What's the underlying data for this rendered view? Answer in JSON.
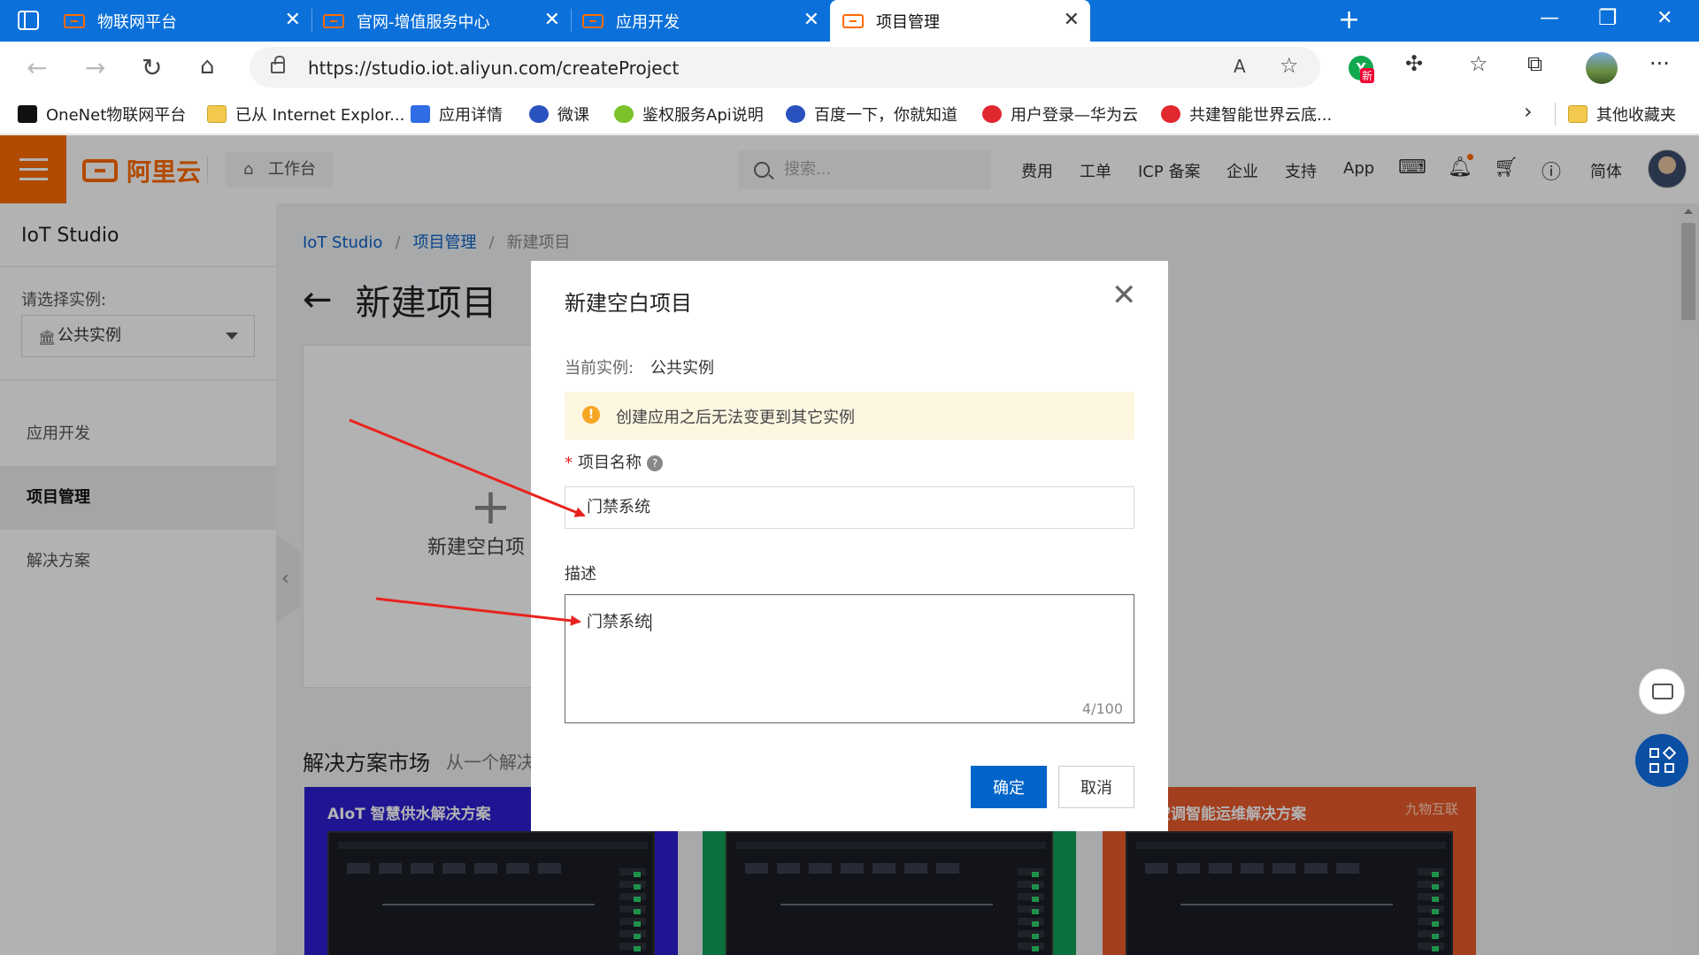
{
  "browser": {
    "tabs": [
      {
        "label": "物联网平台"
      },
      {
        "label": "官网-增值服务中心"
      },
      {
        "label": "应用开发"
      },
      {
        "label": "项目管理"
      }
    ],
    "url": "https://studio.iot.aliyun.com/createProject",
    "read_aloud_label": "A",
    "ext_badge": "新",
    "bookmarks": [
      {
        "label": "OneNet物联网平台",
        "icon": "onenet-icon"
      },
      {
        "label": "已从 Internet Explor...",
        "icon": "folder-icon"
      },
      {
        "label": "应用详情",
        "icon": "app-icon"
      },
      {
        "label": "微课",
        "icon": "weike-icon"
      },
      {
        "label": "鉴权服务Api说明",
        "icon": "leaf-icon"
      },
      {
        "label": "百度一下，你就知道",
        "icon": "baidu-icon"
      },
      {
        "label": "用户登录—华为云",
        "icon": "huawei-icon"
      },
      {
        "label": "共建智能世界云底...",
        "icon": "huawei-icon"
      }
    ],
    "other_bookmarks": "其他收藏夹"
  },
  "header": {
    "logo_text": "阿里云",
    "workbench": "工作台",
    "search_placeholder": "搜索...",
    "links": [
      "费用",
      "工单",
      "ICP 备案",
      "企业",
      "支持",
      "App"
    ],
    "lang": "简体"
  },
  "sidebar": {
    "title": "IoT Studio",
    "instance_label": "请选择实例:",
    "instance_value": "公共实例",
    "items": [
      {
        "label": "应用开发"
      },
      {
        "label": "项目管理"
      },
      {
        "label": "解决方案"
      }
    ]
  },
  "main": {
    "breadcrumb": [
      "IoT Studio",
      "项目管理",
      "新建项目"
    ],
    "breadcrumb_sep": "/",
    "page_title": "新建项目",
    "new_card_label": "新建空白项",
    "solutions_title": "解决方案市场",
    "solutions_subtitle": "从一个解决",
    "solution_cards": [
      {
        "title": "AIoT 智慧供水解决方案",
        "bg": "#2d1fd1"
      },
      {
        "title": "",
        "bg": "#12a05a"
      },
      {
        "title": "中央空调智能运维解决方案",
        "bg": "#ea5a2b",
        "logo": "九物互联"
      }
    ]
  },
  "modal": {
    "title": "新建空白项目",
    "instance_label": "当前实例:",
    "instance_value": "公共实例",
    "alert_text": "创建应用之后无法变更到其它实例",
    "name_label": "项目名称",
    "name_required_mark": "*",
    "help_mark": "?",
    "name_value": "门禁系统",
    "desc_label": "描述",
    "desc_value": "门禁系统",
    "desc_counter": "4/100",
    "ok_label": "确定",
    "cancel_label": "取消"
  },
  "colors": {
    "tab_bar": "#0b70d9",
    "brand_orange": "#ff6a00",
    "primary_button": "#0064c8",
    "alert_bg": "#fdf6e1",
    "annotation_arrow": "#e8231f"
  }
}
